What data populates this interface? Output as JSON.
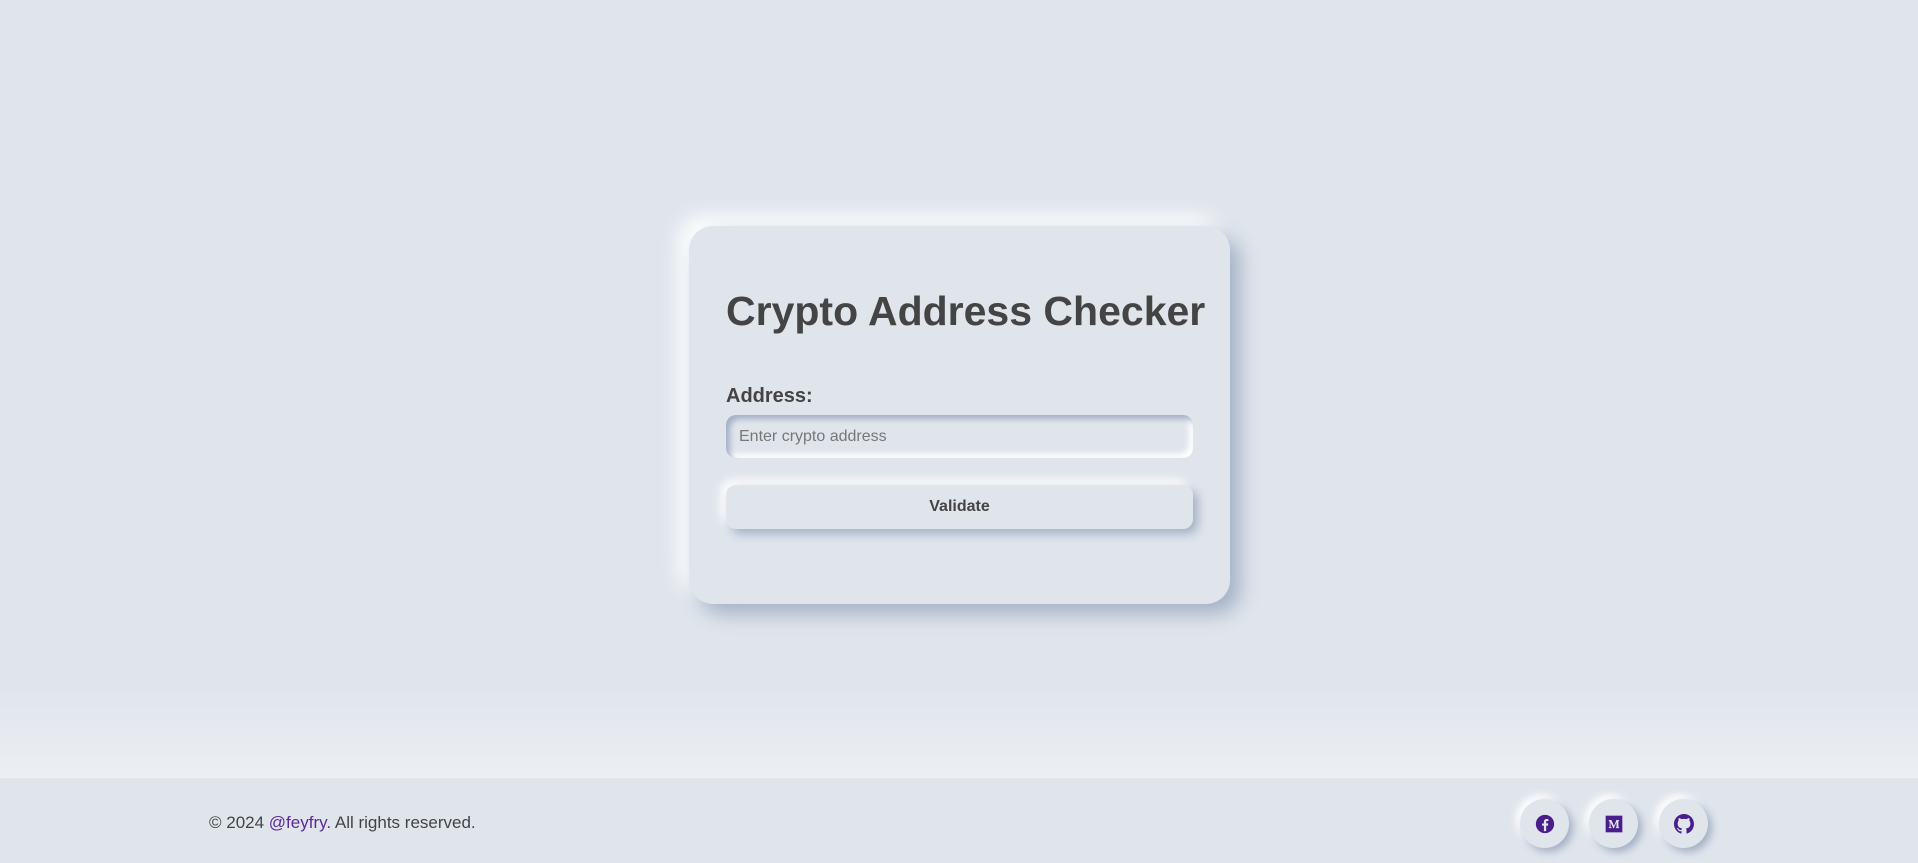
{
  "card": {
    "title": "Crypto Address Checker",
    "address_label": "Address:",
    "address_placeholder": "Enter crypto address",
    "address_value": "",
    "validate_label": "Validate"
  },
  "footer": {
    "copyright_prefix": "© 2024 ",
    "handle": "@feyfry",
    "copyright_suffix": ". All rights reserved.",
    "social": [
      {
        "name": "facebook-icon"
      },
      {
        "name": "medium-icon"
      },
      {
        "name": "github-icon"
      }
    ]
  },
  "colors": {
    "background": "#e0e5ec",
    "text": "#444444",
    "accent": "#4a1d8c",
    "link": "#5b2a98"
  }
}
